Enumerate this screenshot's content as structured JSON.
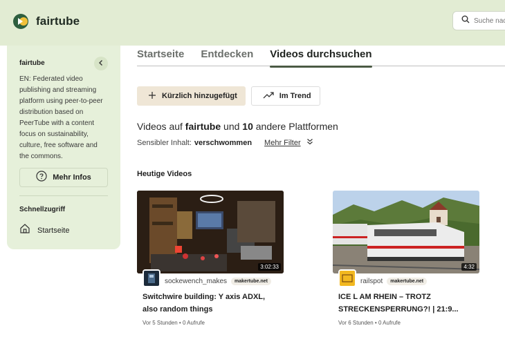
{
  "header": {
    "app_name": "fairtube",
    "search_placeholder": "Suche nach Videos",
    "colors": {
      "header_bg": "#e2ecd3",
      "logo_circle": "#2e5f3f",
      "logo_accent": "#f2c13a"
    }
  },
  "sidebar": {
    "instance_name": "fairtube",
    "description": "EN: Federated video publishing and streaming platform using peer-to-peer distribution based on PeerTube with a content focus on sustainability, culture, free software and the commons.",
    "more_info_label": "Mehr Infos",
    "quick_access_title": "Schnellzugriff",
    "home_label": "Startseite"
  },
  "tabs": [
    {
      "label": "Startseite",
      "active": false
    },
    {
      "label": "Entdecken",
      "active": false
    },
    {
      "label": "Videos durchsuchen",
      "active": true
    }
  ],
  "sort_buttons": {
    "recent_label": "Kürzlich hinzugefügt",
    "trending_label": "Im Trend"
  },
  "browse": {
    "heading_prefix": "Videos auf ",
    "heading_instance": "fairtube",
    "heading_middle": " und ",
    "heading_count": "10",
    "heading_suffix": " andere Plattformen",
    "sensitive_label": "Sensibler Inhalt: ",
    "sensitive_value": "verschwommen",
    "more_filters_label": "Mehr Filter"
  },
  "section": {
    "title": "Heutige Videos"
  },
  "videos": [
    {
      "duration": "3:02:33",
      "channel": "sockewench_makes",
      "instance": "makertube.net",
      "title": "Switchwire building: Y axis ADXL, also random things",
      "info": "Vor 5 Stunden • 0 Aufrufe"
    },
    {
      "duration": "4:32",
      "channel": "railspot",
      "instance": "makertube.net",
      "title": "ICE L AM RHEIN – TROTZ STRECKENSPERRUNG?! | 21:9...",
      "info": "Vor 6 Stunden • 0 Aufrufe"
    }
  ]
}
